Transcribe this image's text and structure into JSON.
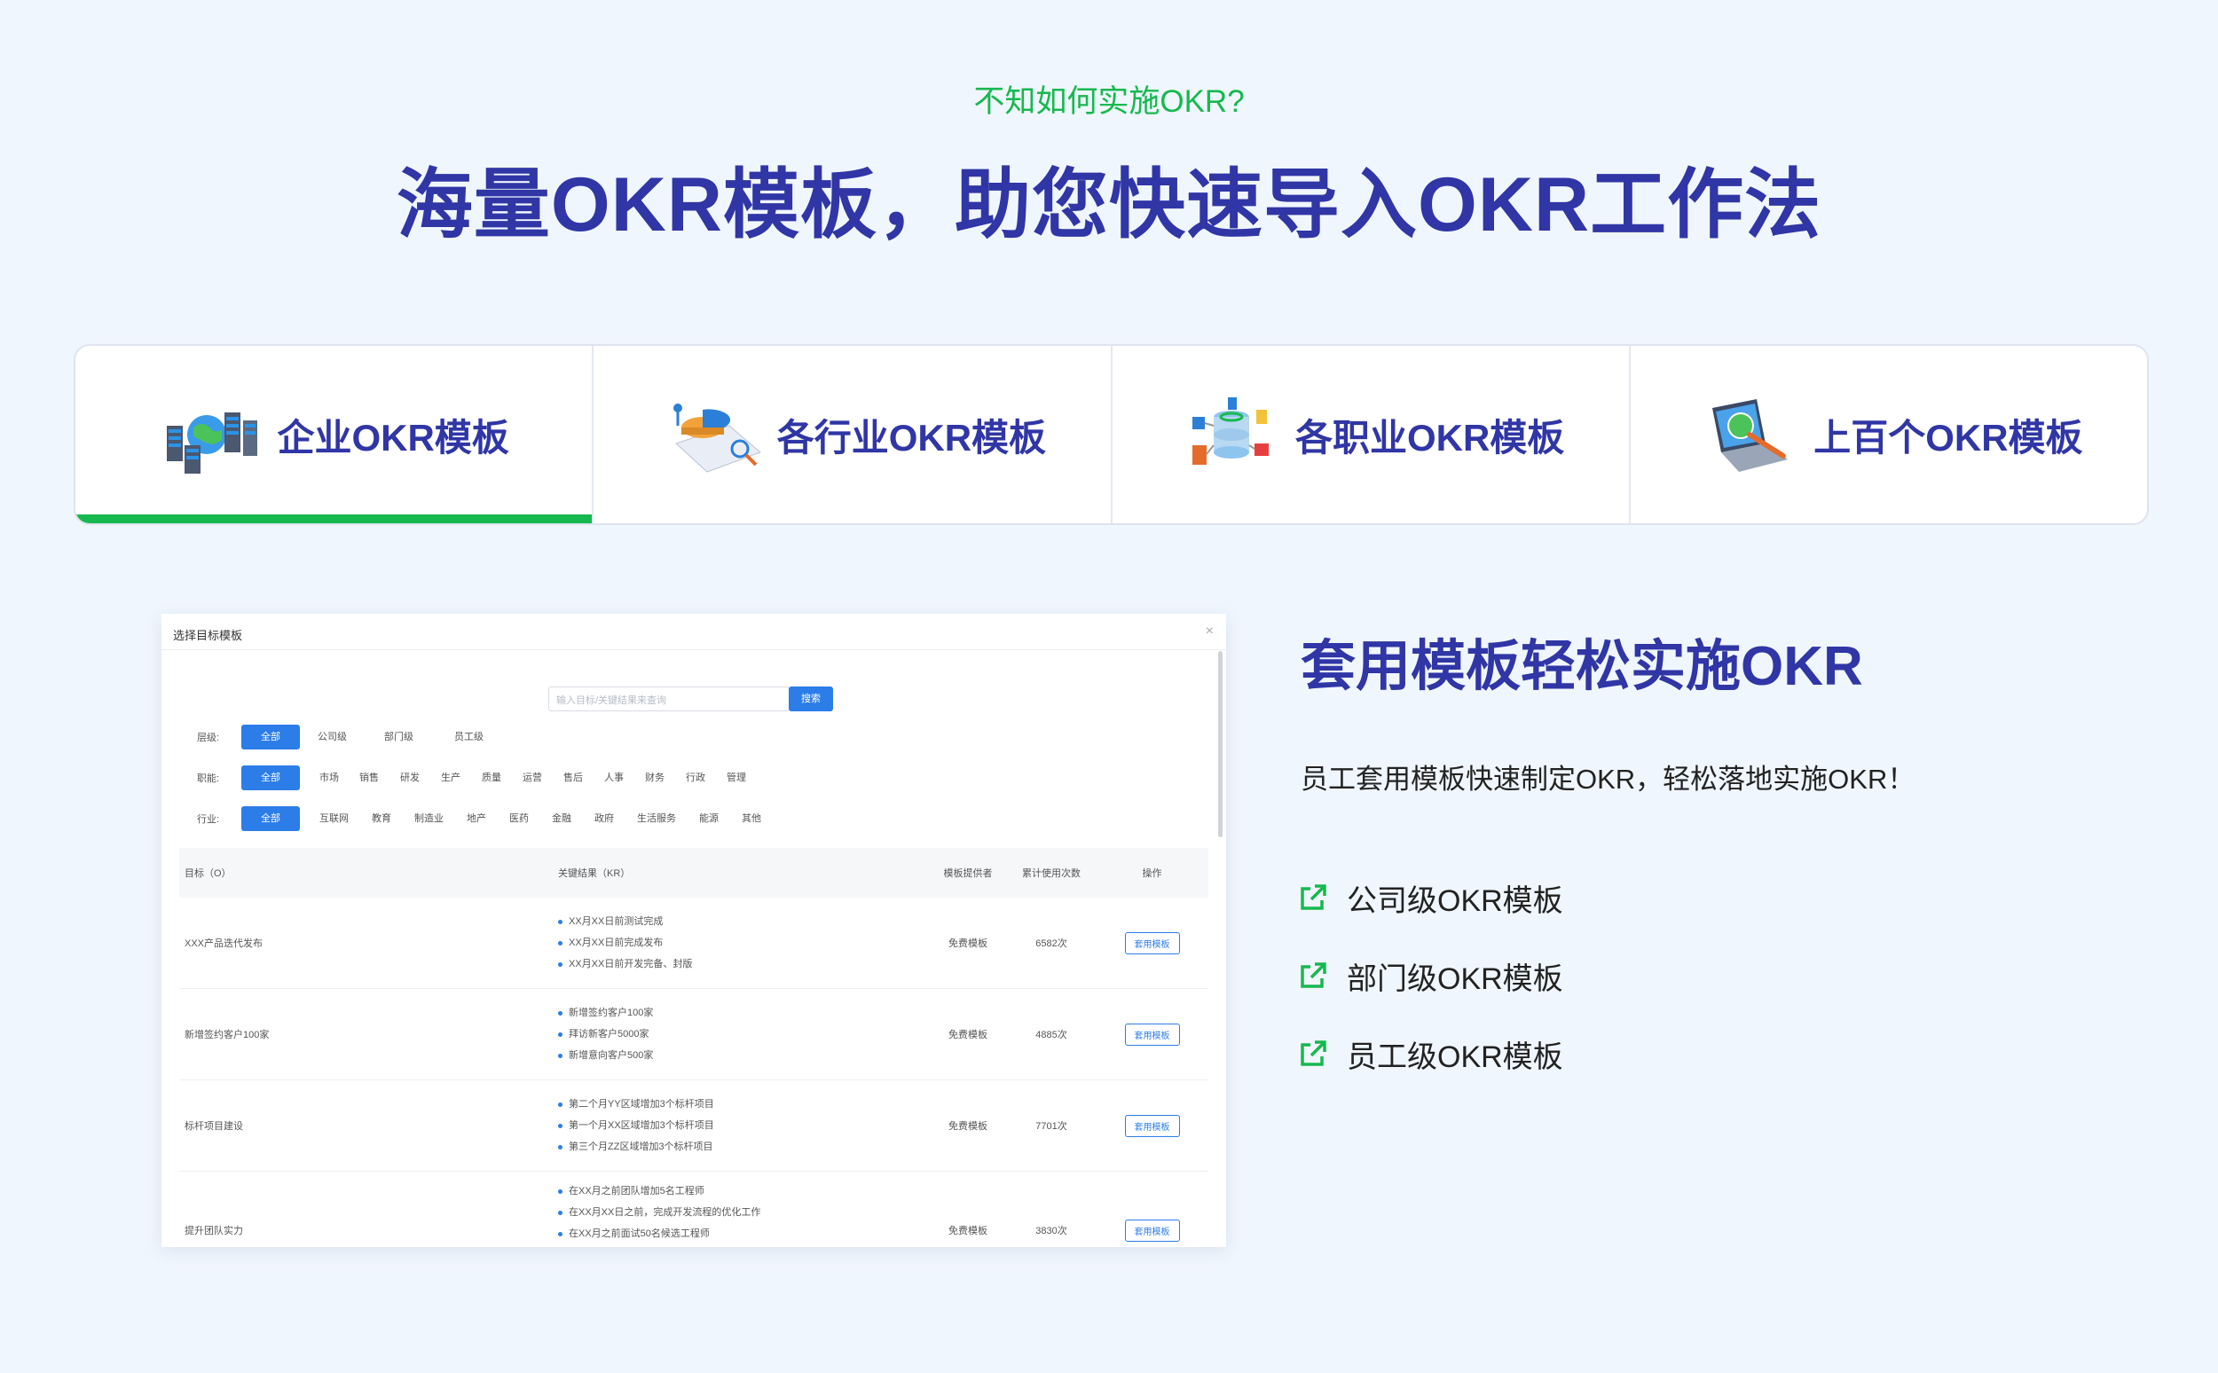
{
  "header": {
    "eyebrow": "不知如何实施OKR?",
    "headline": "海量OKR模板，助您快速导入OKR工作法"
  },
  "tabs": [
    {
      "label": "企业OKR模板",
      "icon": "server-globe-icon",
      "active": true
    },
    {
      "label": "各行业OKR模板",
      "icon": "pie-chart-magnifier-icon",
      "active": false
    },
    {
      "label": "各职业OKR模板",
      "icon": "database-network-icon",
      "active": false
    },
    {
      "label": "上百个OKR模板",
      "icon": "laptop-search-icon",
      "active": false
    }
  ],
  "modal": {
    "title": "选择目标模板",
    "close": "×",
    "search_placeholder": "输入目标/关键结果来查询",
    "search_button": "搜索",
    "filters": {
      "level": {
        "label": "层级:",
        "options": [
          "全部",
          "公司级",
          "部门级",
          "员工级"
        ]
      },
      "role": {
        "label": "职能:",
        "options": [
          "全部",
          "市场",
          "销售",
          "研发",
          "生产",
          "质量",
          "运营",
          "售后",
          "人事",
          "财务",
          "行政",
          "管理"
        ]
      },
      "industry": {
        "label": "行业:",
        "options": [
          "全部",
          "互联网",
          "教育",
          "制造业",
          "地产",
          "医药",
          "金融",
          "政府",
          "生活服务",
          "能源",
          "其他"
        ]
      }
    },
    "table": {
      "headers": {
        "objective": "目标（O）",
        "kr": "关键结果（KR）",
        "provider": "模板提供者",
        "count": "累计使用次数",
        "action": "操作"
      },
      "rows": [
        {
          "objective": "XXX产品迭代发布",
          "krs": [
            "XX月XX日前测试完成",
            "XX月XX日前完成发布",
            "XX月XX日前开发完备、封版"
          ],
          "provider": "免费模板",
          "count": "6582次",
          "action": "套用模板"
        },
        {
          "objective": "新增签约客户100家",
          "krs": [
            "新增签约客户100家",
            "拜访新客户5000家",
            "新增意向客户500家"
          ],
          "provider": "免费模板",
          "count": "4885次",
          "action": "套用模板"
        },
        {
          "objective": "标杆项目建设",
          "krs": [
            "第二个月YY区域增加3个标杆项目",
            "第一个月XX区域增加3个标杆项目",
            "第三个月ZZ区域增加3个标杆项目"
          ],
          "provider": "免费模板",
          "count": "7701次",
          "action": "套用模板"
        },
        {
          "objective": "提升团队实力",
          "krs": [
            "在XX月之前团队增加5名工程师",
            "在XX月XX日之前，完成开发流程的优化工作",
            "在XX月之前面试50名候选工程师"
          ],
          "provider": "免费模板",
          "count": "3830次",
          "action": "套用模板"
        }
      ]
    }
  },
  "right_panel": {
    "title": "套用模板轻松实施OKR",
    "description": "员工套用模板快速制定OKR，轻松落地实施OKR！",
    "links": [
      {
        "label": "公司级OKR模板",
        "icon": "external-link-icon"
      },
      {
        "label": "部门级OKR模板",
        "icon": "external-link-icon"
      },
      {
        "label": "员工级OKR模板",
        "icon": "external-link-icon"
      }
    ],
    "accent_color": "#17b84f"
  },
  "colors": {
    "brand_blue": "#3036a5",
    "accent_green": "#17b84f",
    "button_blue": "#2c7de8",
    "background": "#f0f6fd"
  }
}
